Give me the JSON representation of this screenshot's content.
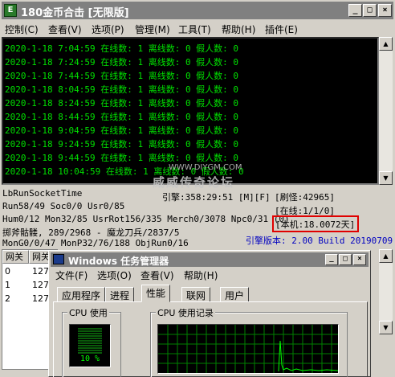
{
  "main_window": {
    "title": "180金币合击 [无限版]",
    "icon_label": "E",
    "buttons": {
      "minimize": "_",
      "maximize": "□",
      "close": "×"
    },
    "menu": [
      "控制(C)",
      "查看(V)",
      "选项(P)",
      "管理(M)",
      "工具(T)",
      "帮助(H)",
      "插件(E)"
    ]
  },
  "log_lines": [
    "2020-1-18 7:04:59 在线数: 1 离线数: 0 假人数: 0",
    "2020-1-18 7:24:59 在线数: 1 离线数: 0 假人数: 0",
    "2020-1-18 7:44:59 在线数: 1 离线数: 0 假人数: 0",
    "2020-1-18 8:04:59 在线数: 1 离线数: 0 假人数: 0",
    "2020-1-18 8:24:59 在线数: 1 离线数: 0 假人数: 0",
    "2020-1-18 8:44:59 在线数: 1 离线数: 0 假人数: 0",
    "2020-1-18 9:04:59 在线数: 1 离线数: 0 假人数: 0",
    "2020-1-18 9:24:59 在线数: 1 离线数: 0 假人数: 0",
    "2020-1-18 9:44:59 在线数: 1 离线数: 0 假人数: 0",
    "2020-1-18 10:04:59 在线数: 1 离线数: 0 假人数: 0"
  ],
  "watermark": {
    "text": "威威传奇论坛",
    "url": "WWW.DIYGM.COM"
  },
  "status": {
    "socket_time": "LbRunSocketTime",
    "engine": "引擎:358:29:51 [M][F]",
    "refresh": "[刷怪:42965]",
    "run_line": "Run58/49 Soc0/0 Usr0/85",
    "online": "[在线:1/1/0]",
    "hum_line": "Hum0/12 Mon32/85 UsrRot156/335 Merch0/3078 Npc0/31 (0)",
    "uptime": "[本机:18.0072天]",
    "map_line": "掷斧骷髅, 289/2968 - 魔龙刀兵/2837/5",
    "version": "引擎版本: 2.00 Build 20190709",
    "mon_line": "MonG0/0/47 MonP32/76/188 ObjRun0/16"
  },
  "grid": {
    "headers": [
      "网关",
      "网关"
    ],
    "rows": [
      [
        "0",
        "127."
      ],
      [
        "1",
        "127."
      ],
      [
        "2",
        "127."
      ]
    ]
  },
  "task_manager": {
    "title": "Windows 任务管理器",
    "buttons": {
      "minimize": "_",
      "maximize": "□",
      "close": "×"
    },
    "menu": [
      "文件(F)",
      "选项(O)",
      "查看(V)",
      "帮助(H)"
    ],
    "tabs": [
      "应用程序",
      "进程",
      "性能",
      "联网",
      "用户"
    ],
    "active_tab": "性能",
    "cpu_usage_label": "CPU 使用",
    "cpu_usage_value": "10 %",
    "cpu_history_label": "CPU 使用记录"
  },
  "colors": {
    "log_text": "#00e000",
    "highlight": "#e00000",
    "version_text": "#0000c0"
  }
}
